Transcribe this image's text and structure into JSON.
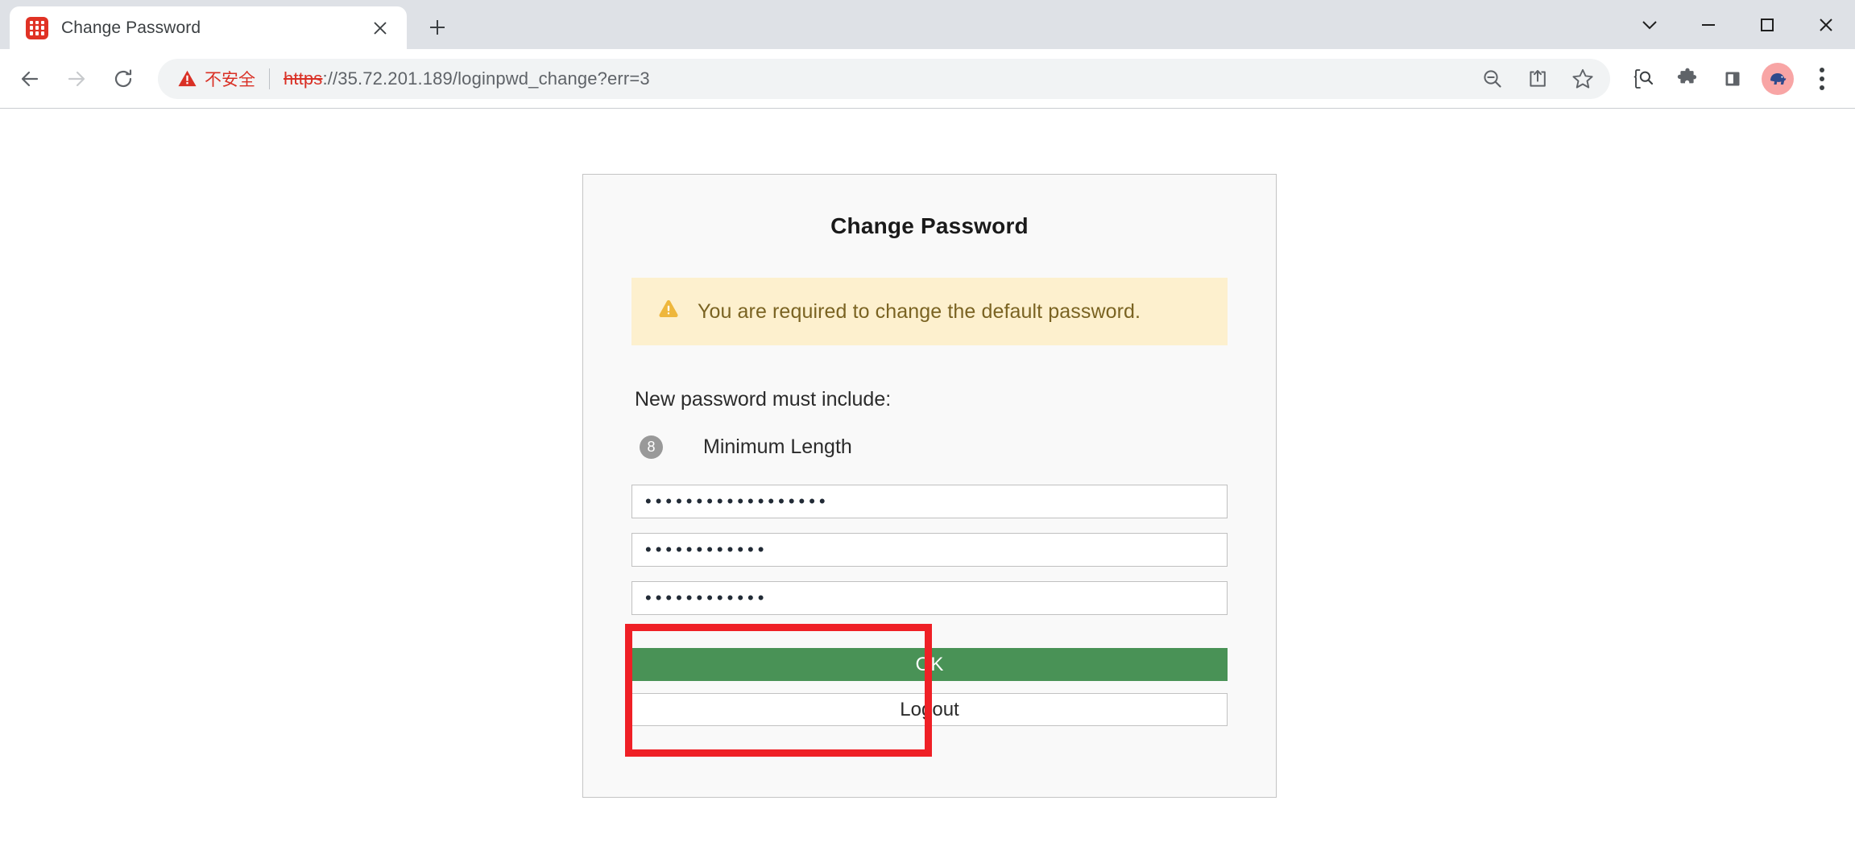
{
  "window": {
    "controls": [
      {
        "name": "tab-search",
        "glyph": "chevron-down"
      },
      {
        "name": "minimize",
        "glyph": "minus"
      },
      {
        "name": "maximize",
        "glyph": "square"
      },
      {
        "name": "close",
        "glyph": "x"
      }
    ]
  },
  "tab": {
    "title": "Change Password",
    "favicon": "grid-icon",
    "close_label": "Close tab",
    "new_tab_label": "New Tab"
  },
  "toolbar": {
    "back_label": "Back",
    "forward_label": "Forward",
    "reload_label": "Reload",
    "security_badge": "不安全",
    "url_scheme": "https",
    "url_rest": "://35.72.201.189/loginpwd_change?err=3",
    "url_full": "https://35.72.201.189/loginpwd_change?err=3",
    "url_host": "35.72.201.189",
    "url_path": "/loginpwd_change?err=3",
    "icons": [
      "zoom-out-icon",
      "share-icon",
      "bookmark-star-icon",
      "inspect-search-icon",
      "extensions-puzzle-icon",
      "side-panel-icon"
    ],
    "avatar_label": "Profile",
    "menu_label": "Customize and control Google Chrome"
  },
  "page": {
    "card_title": "Change Password",
    "alert": {
      "icon": "warning-triangle-icon",
      "text": "You are required to change the default password."
    },
    "requirements_heading": "New password must include:",
    "rules": [
      {
        "badge": "8",
        "label": "Minimum Length"
      }
    ],
    "fields": [
      {
        "name": "current-password",
        "masked_value": "••••••••••••••••••",
        "length": 18
      },
      {
        "name": "new-password",
        "masked_value": "••••••••••••",
        "length": 12
      },
      {
        "name": "confirm-password",
        "masked_value": "••••••••••••",
        "length": 12
      }
    ],
    "buttons": {
      "ok": "OK",
      "logout": "Logout"
    }
  },
  "annotation": {
    "name": "red-highlight-box",
    "color": "#ef2026",
    "targets": "password-fields"
  },
  "colors": {
    "accent_green": "#499256",
    "alert_bg": "#fdf0ce",
    "alert_text": "#7a6322",
    "insecure_red": "#d93025",
    "annotation_red": "#ef2026",
    "tabstrip_bg": "#dee1e6",
    "card_bg": "#f9f9f9"
  }
}
